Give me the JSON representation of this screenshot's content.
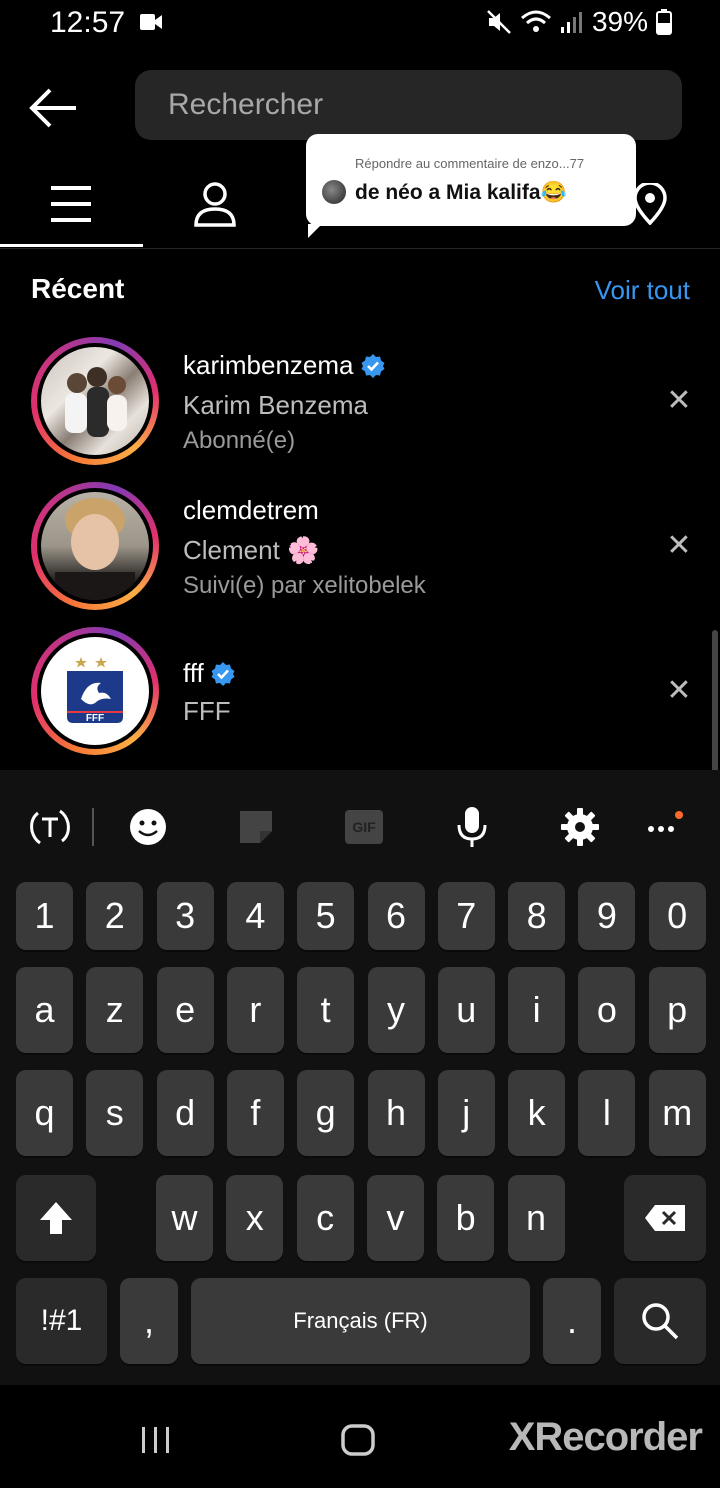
{
  "status_bar": {
    "time": "12:57",
    "battery": "39%"
  },
  "header": {
    "search_placeholder": "Rechercher"
  },
  "tabs": [
    "menu-icon",
    "profile-icon",
    "location-icon"
  ],
  "comment_bubble": {
    "subtitle": "Répondre au commentaire de enzo...77",
    "text": "de néo a Mia kalifa😂"
  },
  "recent": {
    "title": "Récent",
    "see_all": "Voir tout",
    "items": [
      {
        "username": "karimbenzema",
        "verified": true,
        "fullname": "Karim Benzema",
        "subtitle": "Abonné(e)"
      },
      {
        "username": "clemdetrem",
        "verified": false,
        "fullname": "Clement 🌸",
        "subtitle": "Suivi(e) par xelitobelek"
      },
      {
        "username": "fff",
        "verified": true,
        "fullname": "FFF",
        "subtitle": ""
      }
    ],
    "logo_text": "FFF"
  },
  "keyboard": {
    "numbers": [
      "1",
      "2",
      "3",
      "4",
      "5",
      "6",
      "7",
      "8",
      "9",
      "0"
    ],
    "row1": [
      "a",
      "z",
      "e",
      "r",
      "t",
      "y",
      "u",
      "i",
      "o",
      "p"
    ],
    "row2": [
      "q",
      "s",
      "d",
      "f",
      "g",
      "h",
      "j",
      "k",
      "l",
      "m"
    ],
    "row3": [
      "w",
      "x",
      "c",
      "v",
      "b",
      "n"
    ],
    "symbols_label": "!#1",
    "comma": ",",
    "space_label": "Français (FR)",
    "period": ".",
    "gif_label": "GIF"
  },
  "watermark": "XRecorder"
}
